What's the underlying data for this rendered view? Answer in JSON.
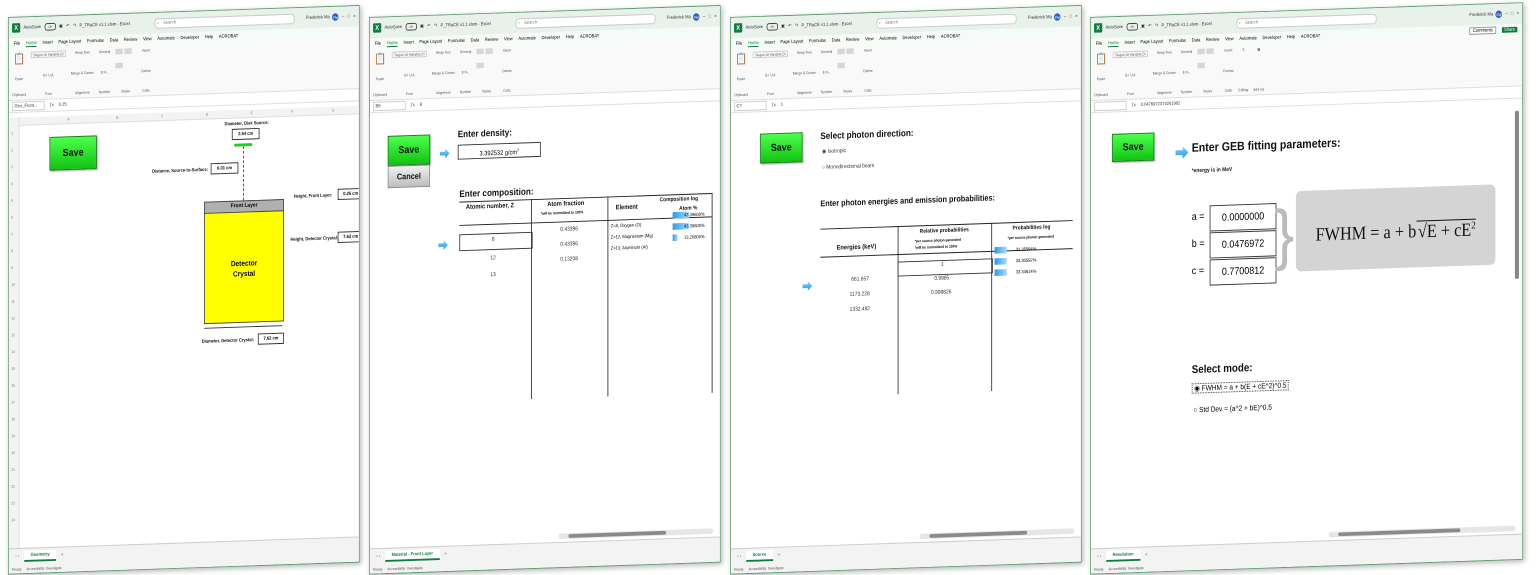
{
  "common": {
    "autosave_label": "AutoSave",
    "autosave_state": "Off",
    "file_name": "P_TRaCE v1.1.xlsm - Excel",
    "search_placeholder": "Search",
    "user_name": "Frederick Ma",
    "user_initials": "FM",
    "menu": [
      "File",
      "Home",
      "Insert",
      "Page Layout",
      "Formulas",
      "Data",
      "Review",
      "View",
      "Automate",
      "Developer",
      "Help",
      "ACROBAT"
    ],
    "font_name": "Segoe UI Variable Di",
    "font_size": "11",
    "groups": [
      "Clipboard",
      "Font",
      "Alignment",
      "Number",
      "Styles",
      "Cells"
    ],
    "paste_label": "Paste",
    "wrap_text": "Wrap Text",
    "merge_center": "Merge & Center",
    "general": "General",
    "conditional_formatting": "Conditional Formatting",
    "format_as_table": "Format as Table",
    "cell_styles": "Cell Styles",
    "insert": "Insert",
    "delete": "Delete",
    "format": "Format",
    "editing": "Editing",
    "add_ins": "Add-ins",
    "ready": "Ready",
    "accessibility": "Accessibility: Investigate",
    "add_sheet": "+",
    "colors": {
      "excel_green": "#107c41",
      "save_green": "#22dd22",
      "arrow_blue": "#2a9be6"
    }
  },
  "win1": {
    "namebox": "Geo_Front...",
    "formula": "0.25",
    "col_a": "A",
    "col_b": "B",
    "col_c": "C",
    "col_d": "D",
    "col_e": "E",
    "col_f": "F",
    "col_g": "G",
    "save": "Save",
    "diameter_source_label": "Diameter, Disk Source:",
    "diameter_source_value": "2.54 cm",
    "distance_label": "Distance, Source-to-Surface:",
    "distance_value": "0.01 cm",
    "height_front_label": "Height, Front Layer:",
    "height_front_value": "0.25 cm",
    "height_crystal_label": "Height, Detector Crystal:",
    "height_crystal_value": "7.62 cm",
    "front_layer": "Front Layer",
    "detector_line1": "Detector",
    "detector_line2": "Crystal",
    "diameter_crystal_label": "Diameter, Detector Crystal:",
    "diameter_crystal_value": "7.62 cm",
    "tab": "Geometry",
    "colors": {
      "crystal": "#ffff00",
      "front_layer": "#b0b0b0"
    }
  },
  "win2": {
    "namebox": "B9",
    "formula": "8",
    "save": "Save",
    "cancel": "Cancel",
    "density_title": "Enter density:",
    "density_value": "3.392532 g/cm",
    "density_exp": "3",
    "composition_title": "Enter composition:",
    "col_z": "Atomic number, Z",
    "col_frac": "Atom fraction",
    "col_frac_note": "*will be normalized to 100%",
    "col_el": "Element",
    "col_log": "Composition log",
    "col_atom": "Atom %",
    "z": [
      "8",
      "12",
      "13"
    ],
    "frac": [
      "0.43396",
      "0.43396",
      "0.13208"
    ],
    "elements": [
      "Z=8, Oxygen (O)",
      "Z=12, Magnesium (Mg)",
      "Z=13, Aluminum (Al)"
    ],
    "atom_pct": [
      "43.39600%",
      "43.39600%",
      "13.20800%"
    ],
    "atom_pct_fill": [
      43.396,
      43.396,
      13.208
    ],
    "tab": "Material - Front Layer"
  },
  "win3": {
    "namebox": "C7",
    "formula": "1",
    "save": "Save",
    "direction_title": "Select photon direction:",
    "isotropic": "Isotropic",
    "mono": "Monodirectional beam",
    "energies_title": "Enter photon energies and emission probabilities:",
    "col_energy": "Energies (keV)",
    "col_rel": "Relative probabilities",
    "col_rel_note1": "*per source photon generated",
    "col_rel_note2": "*will be normalized to 100%",
    "col_log": "Probabilities log",
    "col_log_note": "*per source photon generated",
    "energies": [
      "661.657",
      "1173.228",
      "1332.492"
    ],
    "rel": [
      "1",
      "0.9985",
      "0.999826"
    ],
    "log": [
      "33.35594%",
      "33.30592%",
      "33.34614%"
    ],
    "log_fill": [
      33.35594,
      33.30592,
      33.34614
    ],
    "tab": "Source"
  },
  "win4": {
    "namebox": "",
    "formula": "0.0476972374261902",
    "save": "Save",
    "title": "Enter GEB fitting parameters:",
    "note": "*energy is in MeV",
    "a_label": "a =",
    "b_label": "b =",
    "c_label": "c =",
    "a": "0.0000000",
    "b": "0.0476972",
    "c": "0.7700812",
    "formula_lhs": "FWHM = a + b",
    "formula_rad": "E + cE",
    "formula_sup": "2",
    "mode_title": "Select mode:",
    "mode1": "FWHM = a + b(E + cE^2)^0.5",
    "mode2": "Std Dev = (a^2 + bE)^0.5",
    "comments": "Comments",
    "share": "Share",
    "tab": "Resolution"
  }
}
